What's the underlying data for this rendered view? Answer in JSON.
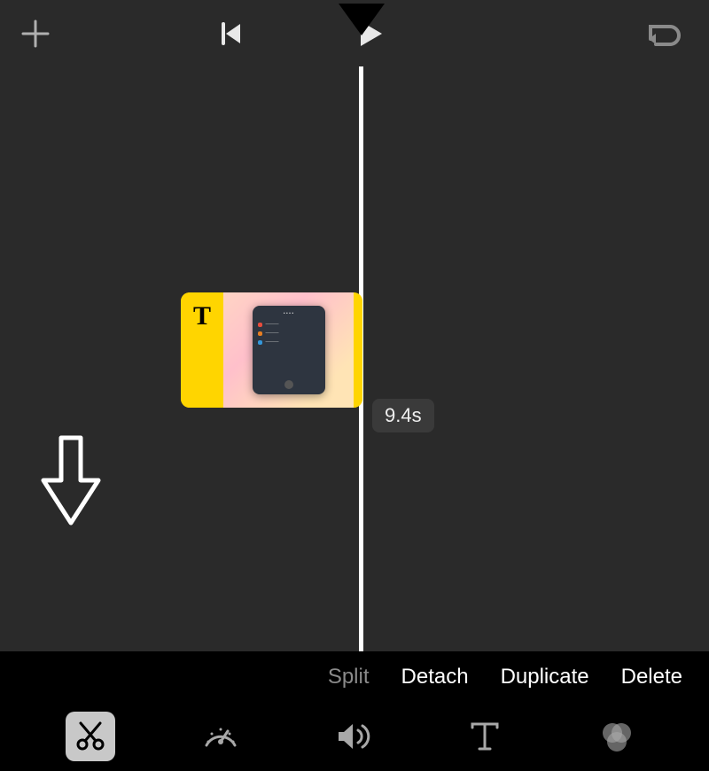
{
  "clip": {
    "title_indicator": "T",
    "duration_label": "9.4s"
  },
  "actions": {
    "split": "Split",
    "detach": "Detach",
    "duplicate": "Duplicate",
    "delete": "Delete"
  },
  "icons": {
    "add": "add-icon",
    "skip_back": "skip-back-icon",
    "play": "play-icon",
    "undo": "undo-icon",
    "scissors": "scissors-icon",
    "speed": "speed-icon",
    "volume": "volume-icon",
    "text": "text-icon",
    "filters": "filters-icon"
  }
}
